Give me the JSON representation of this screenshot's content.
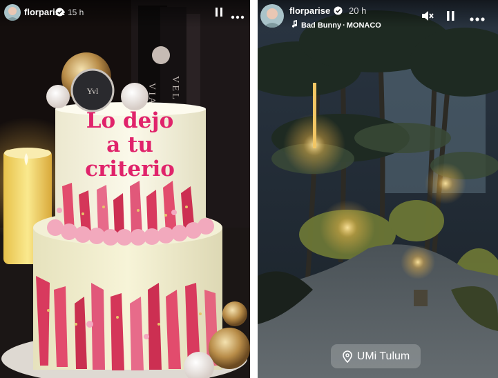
{
  "stories": [
    {
      "username": "florparise",
      "timestamp": "15 h",
      "controls": {
        "pause_icon": "pause-icon",
        "more_icon": "more-horizontal-icon"
      },
      "cake_text": [
        "Lo dejo",
        "a tu",
        "criterio"
      ]
    },
    {
      "username": "florparise",
      "timestamp": "20 h",
      "music": {
        "artist": "Bad Bunny",
        "song": "MONACO",
        "icon": "music-note-icon"
      },
      "controls": {
        "mute_icon": "speaker-muted-icon",
        "pause_icon": "pause-icon",
        "more_icon": "more-horizontal-icon"
      },
      "location": {
        "label": "UMi Tulum",
        "icon": "location-pin-icon"
      }
    }
  ],
  "colors": {
    "cake_text_pink": "#e0236b",
    "candle_glow": "#f7e7a0",
    "lamp_glow": "#ffd36e"
  }
}
